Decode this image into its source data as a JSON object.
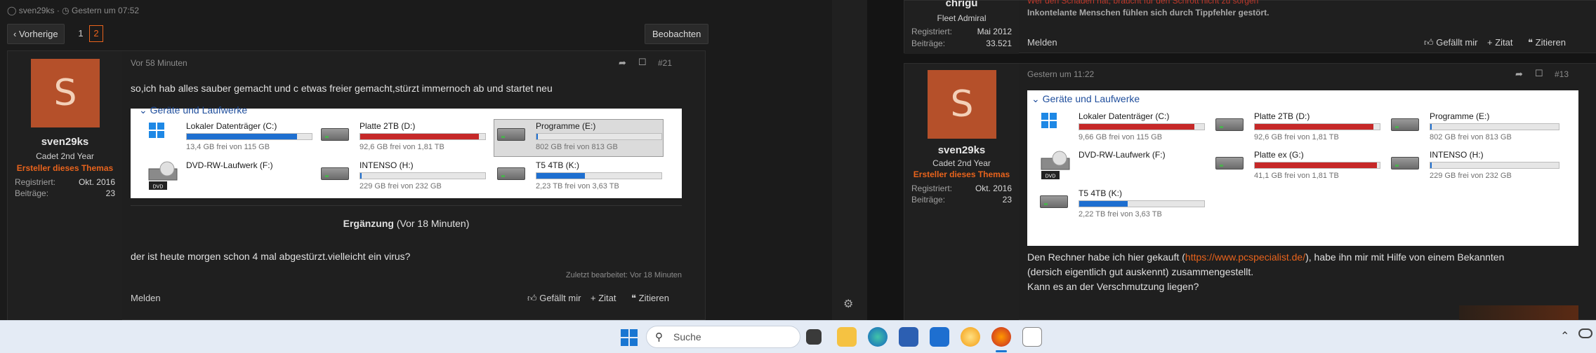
{
  "left": {
    "meta_author": "sven29ks",
    "meta_date": "Gestern um 07:52",
    "pager": {
      "prev": "Vorherige",
      "page1": "1",
      "page2": "2"
    },
    "watch_label": "Beobachten",
    "post": {
      "time": "Vor 58 Minuten",
      "number": "#21",
      "user": {
        "avatar_letter": "S",
        "name": "sven29ks",
        "rank": "Cadet 2nd Year",
        "starter": "Ersteller dieses Themas",
        "reg_label": "Registriert:",
        "reg_value": "Okt. 2016",
        "posts_label": "Beiträge:",
        "posts_value": "23"
      },
      "text": "so,ich hab alles sauber gemacht und c etwas freier gemacht,stürzt immernoch ab und startet neu",
      "drives_header": "Geräte und Laufwerke",
      "drives": [
        {
          "name": "Lokaler Datenträger (C:)",
          "free": "13,4 GB frei von 115 GB",
          "fill": 0.88,
          "color": "#1e6fd0",
          "icon": "windows-drive-icon"
        },
        {
          "name": "Platte 2TB (D:)",
          "free": "92,6 GB frei von 1,81 TB",
          "fill": 0.95,
          "color": "#c62828",
          "icon": "hard-drive-icon"
        },
        {
          "name": "Programme (E:)",
          "free": "802 GB frei von 813 GB",
          "fill": 0.01,
          "color": "#1e6fd0",
          "icon": "hard-drive-icon"
        },
        {
          "name": "DVD-RW-Laufwerk (F:)",
          "free": "",
          "fill": 0,
          "color": "#1e6fd0",
          "icon": "dvd-drive-icon"
        },
        {
          "name": "INTENSO (H:)",
          "free": "229 GB frei von 232 GB",
          "fill": 0.01,
          "color": "#1e6fd0",
          "icon": "hard-drive-icon"
        },
        {
          "name": "T5 4TB (K:)",
          "free": "2,23 TB frei von 3,63 TB",
          "fill": 0.39,
          "color": "#1e6fd0",
          "icon": "hard-drive-icon"
        }
      ],
      "supplement_label": "Ergänzung",
      "supplement_time": "(Vor 18 Minuten)",
      "supplement_text": "der ist heute morgen schon 4 mal abgestürzt.vielleicht ein virus?",
      "edited": "Zuletzt bearbeitet: Vor 18 Minuten",
      "report": "Melden",
      "like": "Gefällt mir",
      "quote": "Zitat",
      "cite": "Zitieren"
    }
  },
  "right": {
    "top_user": {
      "name": "chrigu",
      "rank": "Fleet Admiral",
      "reg_label": "Registriert:",
      "reg_value": "Mai 2012",
      "posts_label": "Beiträge:",
      "posts_value": "33.521"
    },
    "top_text_line1": "Wer den Schaden hat, braucht für den Schrott nicht zu sorgen",
    "top_text_line2": "Inkontelante Menschen fühlen sich durch Tippfehler gestört.",
    "top_report": "Melden",
    "top_like": "Gefällt mir",
    "top_quote": "Zitat",
    "top_cite": "Zitieren",
    "post": {
      "time": "Gestern um 11:22",
      "number": "#13",
      "user": {
        "avatar_letter": "S",
        "name": "sven29ks",
        "rank": "Cadet 2nd Year",
        "starter": "Ersteller dieses Themas",
        "reg_label": "Registriert:",
        "reg_value": "Okt. 2016",
        "posts_label": "Beiträge:",
        "posts_value": "23"
      },
      "drives_header": "Geräte und Laufwerke",
      "drives": [
        {
          "name": "Lokaler Datenträger (C:)",
          "free": "9,66 GB frei von 115 GB",
          "fill": 0.92,
          "color": "#c62828",
          "icon": "windows-drive-icon"
        },
        {
          "name": "Platte 2TB (D:)",
          "free": "92,6 GB frei von 1,81 TB",
          "fill": 0.95,
          "color": "#c62828",
          "icon": "hard-drive-icon"
        },
        {
          "name": "Programme (E:)",
          "free": "802 GB frei von 813 GB",
          "fill": 0.01,
          "color": "#1e6fd0",
          "icon": "hard-drive-icon"
        },
        {
          "name": "DVD-RW-Laufwerk (F:)",
          "free": "",
          "fill": 0,
          "color": "#1e6fd0",
          "icon": "dvd-drive-icon"
        },
        {
          "name": "Platte ex (G:)",
          "free": "41,1 GB frei von 1,81 TB",
          "fill": 0.98,
          "color": "#c62828",
          "icon": "hard-drive-icon"
        },
        {
          "name": "INTENSO (H:)",
          "free": "229 GB frei von 232 GB",
          "fill": 0.01,
          "color": "#1e6fd0",
          "icon": "hard-drive-icon"
        },
        {
          "name": "T5 4TB (K:)",
          "free": "2,22 TB frei von 3,63 TB",
          "fill": 0.39,
          "color": "#1e6fd0",
          "icon": "hard-drive-icon"
        }
      ],
      "text1_before": "Den Rechner habe ich hier gekauft (",
      "text1_link": "https://www.pcspecialist.de/",
      "text1_after": "), habe ihn mir mit Hilfe von einem Bekannten",
      "text2": "(dersich eigentlich gut auskennt) zusammengestellt.",
      "text3": "Kann es an der Verschmutzung liegen?"
    }
  },
  "taskbar": {
    "search_placeholder": "Suche",
    "dvd_label": "DVD"
  }
}
